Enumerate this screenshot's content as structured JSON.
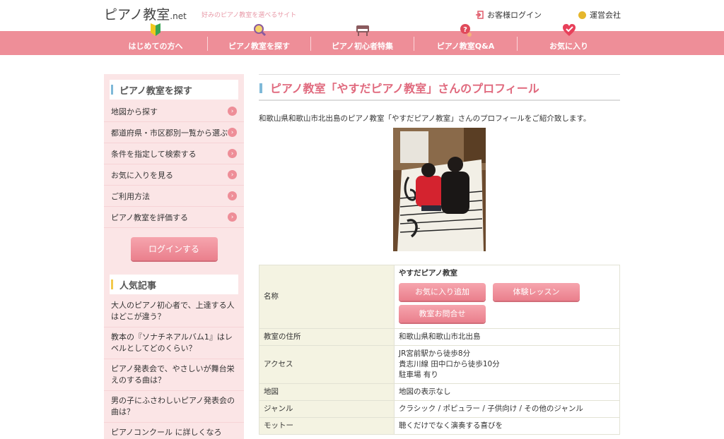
{
  "header": {
    "logo_text": "ピアノ教室",
    "logo_suffix": ".net",
    "tagline": "好みのピアノ教室を選べるサイト",
    "login_link": "お客様ログイン",
    "company_link": "運営会社"
  },
  "nav": {
    "items": [
      {
        "label": "はじめての方へ",
        "icon": "beginner-leaf-icon"
      },
      {
        "label": "ピアノ教室を探す",
        "icon": "magnifier-icon"
      },
      {
        "label": "ピアノ初心者特集",
        "icon": "piano-icon"
      },
      {
        "label": "ピアノ教室Q&A",
        "icon": "question-icon"
      },
      {
        "label": "お気に入り",
        "icon": "heart-icon"
      }
    ]
  },
  "sidebar": {
    "search_heading": "ピアノ教室を探す",
    "search_items": [
      {
        "label": "地図から探す"
      },
      {
        "label": "都道府県・市区郡別一覧から選ぶ"
      },
      {
        "label": "条件を指定して検索する"
      },
      {
        "label": "お気に入りを見る"
      },
      {
        "label": "ご利用方法"
      },
      {
        "label": "ピアノ教室を評価する"
      }
    ],
    "login_button": "ログインする",
    "popular_heading": "人気記事",
    "popular_items": [
      {
        "label": "大人のピアノ初心者で、上達する人はどこが違う？"
      },
      {
        "label": "教本の『ソナチネアルバム1』はレベルとしてどのくらい？"
      },
      {
        "label": "ピアノ発表会で、やさしいが舞台栄えのする曲は？"
      },
      {
        "label": "男の子にふさわしいピアノ発表会の曲は？"
      },
      {
        "label": "ピアノコンクール に詳しくなろう！"
      }
    ]
  },
  "main": {
    "title": "ピアノ教室「やすだピアノ教室」さんのプロフィール",
    "intro": "和歌山県和歌山市北出島のピアノ教室「やすだピアノ教室」さんのプロフィールをご紹介致します。",
    "profile": {
      "name_key": "名称",
      "name_value": "やすだピアノ教室",
      "fav_button": "お気に入り追加",
      "trial_button": "体験レッスン",
      "contact_button": "教室お問合せ",
      "address_key": "教室の住所",
      "address_value": "和歌山県和歌山市北出島",
      "access_key": "アクセス",
      "access_lines": [
        "JR宮前駅から徒歩8分",
        "貴志川線 田中口から徒歩10分",
        "駐車場 有り"
      ],
      "map_key": "地図",
      "map_value": "地図の表示なし",
      "genre_key": "ジャンル",
      "genre_value": "クラシック / ポピュラー / 子供向け / その他のジャンル",
      "motto_key": "モットー",
      "motto_value": "聴くだけでなく演奏する喜びを"
    }
  },
  "colors": {
    "nav_pink": "#ee8e98",
    "sidebar_bg": "#fbe5e6",
    "title_pink": "#e06a7e",
    "accent_blue": "#7fb9d8",
    "table_key_bg": "#f4f3e2"
  }
}
